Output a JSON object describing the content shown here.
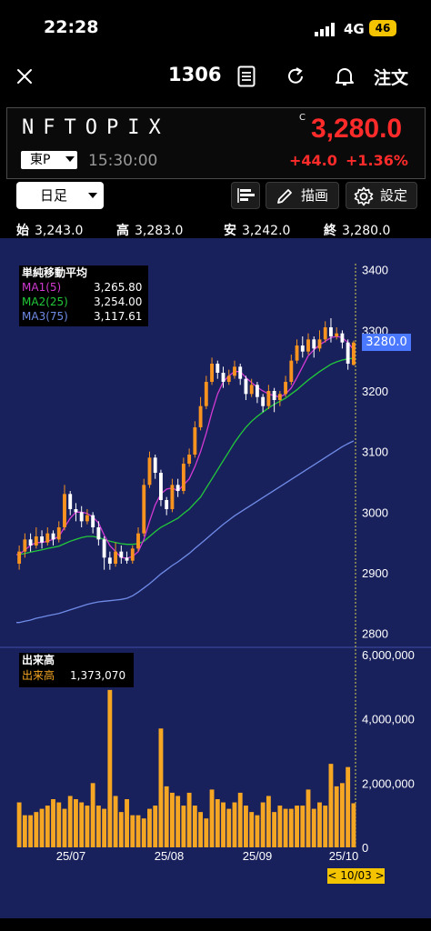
{
  "status": {
    "time": "22:28",
    "network": "4G",
    "battery": "46"
  },
  "nav": {
    "ticker": "1306",
    "order_label": "注文"
  },
  "quote": {
    "name": "NFTOPIX",
    "flag": "C",
    "price": "3,280.0",
    "exchange": "東P",
    "time": "15:30:00",
    "change": "+44.0",
    "change_pct": "+1.36%"
  },
  "toolbar": {
    "period": "日足",
    "draw_label": "描画",
    "settings_label": "設定"
  },
  "ohlc": {
    "open_label": "始",
    "open": "3,243.0",
    "high_label": "高",
    "high": "3,283.0",
    "low_label": "安",
    "low": "3,242.0",
    "close_label": "終",
    "close": "3,280.0"
  },
  "legend": {
    "title": "単純移動平均",
    "ma1_label": "MA1(5)",
    "ma1_value": "3,265.80",
    "ma2_label": "MA2(25)",
    "ma2_value": "3,254.00",
    "ma3_label": "MA3(75)",
    "ma3_value": "3,117.61"
  },
  "volume_legend": {
    "title": "出来高",
    "label": "出来高",
    "value": "1,373,070"
  },
  "price_tag": "3280.0",
  "date_tag": "< 10/03 >",
  "colors": {
    "up": "#f7931e",
    "down": "#ffffff",
    "ma1": "#d23ad2",
    "ma2": "#22c93a",
    "ma3": "#6f8be6",
    "volume": "#f5a623",
    "price_red": "#ff2b2b"
  },
  "chart_data": {
    "type": "candlestick",
    "y_ticks": [
      "3400",
      "3300",
      "3200",
      "3100",
      "3000",
      "2900",
      "2800"
    ],
    "ylim": [
      2780,
      3410
    ],
    "volume_ticks": [
      "6,000,000",
      "4,000,000",
      "2,000,000",
      "0"
    ],
    "volume_ylim": [
      0,
      6000000
    ],
    "x_ticks": [
      "25/07",
      "25/08",
      "25/09",
      "25/10"
    ],
    "candles": [
      [
        2915,
        2935,
        2905,
        2945
      ],
      [
        2935,
        2955,
        2925,
        2965
      ],
      [
        2955,
        2945,
        2935,
        2965
      ],
      [
        2945,
        2960,
        2940,
        2975
      ],
      [
        2960,
        2950,
        2940,
        2970
      ],
      [
        2950,
        2965,
        2945,
        2975
      ],
      [
        2965,
        2955,
        2945,
        2970
      ],
      [
        2955,
        2975,
        2950,
        2985
      ],
      [
        2975,
        3030,
        2970,
        3045
      ],
      [
        3030,
        3005,
        2995,
        3035
      ],
      [
        3005,
        3000,
        2985,
        3015
      ],
      [
        3000,
        2985,
        2975,
        3010
      ],
      [
        2985,
        2995,
        2980,
        3005
      ],
      [
        2995,
        2975,
        2965,
        3000
      ],
      [
        2975,
        2955,
        2945,
        2985
      ],
      [
        2955,
        2925,
        2905,
        2960
      ],
      [
        2925,
        2915,
        2905,
        2935
      ],
      [
        2915,
        2935,
        2910,
        2950
      ],
      [
        2935,
        2925,
        2915,
        2945
      ],
      [
        2925,
        2920,
        2915,
        2935
      ],
      [
        2920,
        2940,
        2915,
        2945
      ],
      [
        2940,
        2965,
        2935,
        2975
      ],
      [
        2965,
        3045,
        2960,
        3055
      ],
      [
        3045,
        3090,
        3040,
        3100
      ],
      [
        3090,
        3065,
        3055,
        3095
      ],
      [
        3065,
        3020,
        3010,
        3070
      ],
      [
        3020,
        3005,
        2995,
        3025
      ],
      [
        3005,
        3045,
        3000,
        3055
      ],
      [
        3045,
        3035,
        3025,
        3055
      ],
      [
        3035,
        3080,
        3030,
        3090
      ],
      [
        3080,
        3095,
        3075,
        3105
      ],
      [
        3095,
        3140,
        3090,
        3150
      ],
      [
        3140,
        3175,
        3135,
        3190
      ],
      [
        3175,
        3215,
        3170,
        3225
      ],
      [
        3215,
        3245,
        3210,
        3255
      ],
      [
        3245,
        3230,
        3220,
        3250
      ],
      [
        3230,
        3215,
        3205,
        3240
      ],
      [
        3215,
        3225,
        3210,
        3235
      ],
      [
        3225,
        3240,
        3220,
        3250
      ],
      [
        3240,
        3220,
        3210,
        3245
      ],
      [
        3220,
        3195,
        3185,
        3225
      ],
      [
        3195,
        3210,
        3190,
        3220
      ],
      [
        3210,
        3190,
        3180,
        3215
      ],
      [
        3190,
        3175,
        3165,
        3195
      ],
      [
        3175,
        3200,
        3170,
        3210
      ],
      [
        3200,
        3185,
        3165,
        3205
      ],
      [
        3185,
        3195,
        3175,
        3200
      ],
      [
        3195,
        3215,
        3190,
        3225
      ],
      [
        3215,
        3250,
        3210,
        3260
      ],
      [
        3250,
        3275,
        3245,
        3285
      ],
      [
        3275,
        3265,
        3255,
        3290
      ],
      [
        3265,
        3285,
        3260,
        3295
      ],
      [
        3285,
        3270,
        3255,
        3290
      ],
      [
        3270,
        3285,
        3265,
        3300
      ],
      [
        3285,
        3305,
        3280,
        3315
      ],
      [
        3305,
        3290,
        3280,
        3320
      ],
      [
        3290,
        3295,
        3285,
        3305
      ],
      [
        3295,
        3280,
        3270,
        3300
      ],
      [
        3280,
        3245,
        3235,
        3285
      ],
      [
        3243,
        3280,
        3242,
        3283
      ]
    ],
    "ma1": [
      2930,
      2938,
      2945,
      2950,
      2950,
      2952,
      2955,
      2960,
      2975,
      2990,
      3000,
      3000,
      2998,
      2992,
      2982,
      2962,
      2945,
      2935,
      2925,
      2924,
      2927,
      2935,
      2955,
      2985,
      3012,
      3030,
      3038,
      3040,
      3035,
      3045,
      3055,
      3075,
      3100,
      3130,
      3165,
      3195,
      3215,
      3225,
      3232,
      3232,
      3222,
      3214,
      3206,
      3200,
      3195,
      3192,
      3190,
      3195,
      3205,
      3222,
      3240,
      3258,
      3268,
      3276,
      3282,
      3288,
      3290,
      3288,
      3280,
      3268
    ],
    "ma2": [
      2930,
      2932,
      2934,
      2936,
      2938,
      2940,
      2942,
      2944,
      2948,
      2952,
      2955,
      2958,
      2960,
      2960,
      2958,
      2955,
      2952,
      2950,
      2948,
      2947,
      2947,
      2948,
      2952,
      2960,
      2968,
      2975,
      2980,
      2985,
      2990,
      2998,
      3005,
      3015,
      3025,
      3040,
      3055,
      3070,
      3085,
      3100,
      3115,
      3128,
      3140,
      3150,
      3158,
      3165,
      3172,
      3178,
      3183,
      3188,
      3195,
      3202,
      3210,
      3218,
      3225,
      3232,
      3238,
      3244,
      3248,
      3251,
      3253,
      3254
    ],
    "ma3": [
      2818,
      2820,
      2822,
      2825,
      2827,
      2829,
      2831,
      2833,
      2836,
      2839,
      2842,
      2845,
      2848,
      2850,
      2852,
      2853,
      2854,
      2855,
      2856,
      2858,
      2862,
      2868,
      2875,
      2882,
      2890,
      2898,
      2905,
      2912,
      2918,
      2925,
      2932,
      2940,
      2948,
      2956,
      2964,
      2972,
      2980,
      2987,
      2994,
      3000,
      3006,
      3012,
      3018,
      3024,
      3030,
      3036,
      3042,
      3048,
      3054,
      3060,
      3066,
      3072,
      3078,
      3084,
      3090,
      3096,
      3102,
      3108,
      3113,
      3117.61
    ],
    "volume": [
      1400000,
      1000000,
      1000000,
      1100000,
      1200000,
      1300000,
      1500000,
      1400000,
      1200000,
      1600000,
      1500000,
      1400000,
      1300000,
      2000000,
      1300000,
      1200000,
      4900000,
      1600000,
      1100000,
      1500000,
      1000000,
      1000000,
      900000,
      1200000,
      1300000,
      3700000,
      1900000,
      1700000,
      1600000,
      1300000,
      1700000,
      1300000,
      1100000,
      900000,
      1800000,
      1500000,
      1400000,
      1200000,
      1400000,
      1700000,
      1300000,
      1100000,
      1000000,
      1400000,
      1600000,
      1100000,
      1300000,
      1200000,
      1200000,
      1300000,
      1300000,
      1800000,
      1200000,
      1400000,
      1300000,
      2600000,
      1900000,
      2000000,
      2500000,
      1373070
    ]
  }
}
